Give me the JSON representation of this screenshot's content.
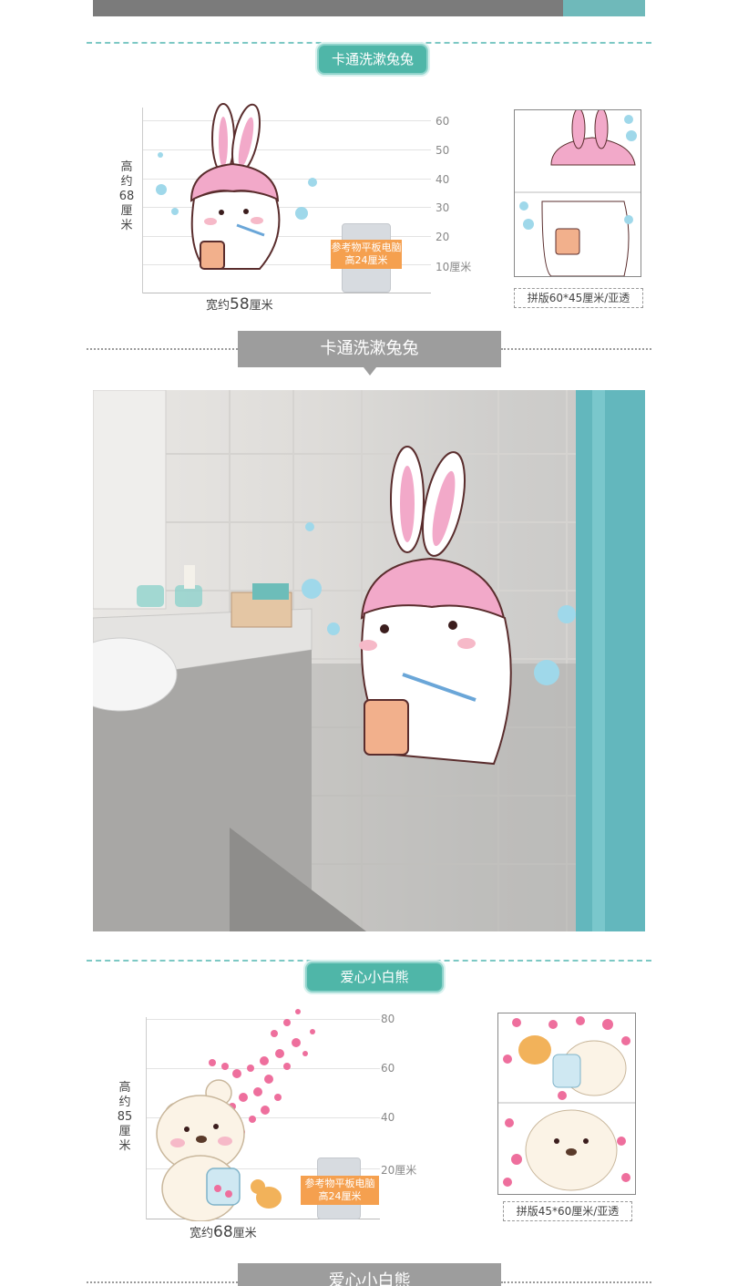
{
  "section1": {
    "pill_label": "卡通洗漱兔兔",
    "height_label": [
      "高",
      "约"
    ],
    "height_value": "68",
    "height_unit": [
      "厘",
      "米"
    ],
    "width_label_prefix": "宽约",
    "width_value": "58",
    "width_unit": "厘米",
    "y_ticks": [
      "60",
      "50",
      "40",
      "30",
      "20",
      "10厘米"
    ],
    "reference_tag": [
      "参考物平板电脑",
      "高24厘米"
    ],
    "thumb_caption": "拼版60*45厘米/亚透"
  },
  "banner1": {
    "label": "卡通洗漱兔兔"
  },
  "section2": {
    "pill_label": "爱心小白熊",
    "height_label": [
      "高",
      "约"
    ],
    "height_value": "85",
    "height_unit": [
      "厘",
      "米"
    ],
    "width_label_prefix": "宽约",
    "width_value": "68",
    "width_unit": "厘米",
    "y_ticks": [
      "80",
      "60",
      "40",
      "20厘米"
    ],
    "reference_tag": [
      "参考物平板电脑",
      "高24厘米"
    ],
    "thumb_caption": "拼版45*60厘米/亚透"
  },
  "banner2": {
    "label": "爱心小白熊"
  },
  "colors": {
    "teal_accent": "#4fb6a8",
    "banner_gray": "#9d9d9d",
    "reference_orange": "#f5a04f",
    "rabbit_pink": "#f2a9c9"
  }
}
